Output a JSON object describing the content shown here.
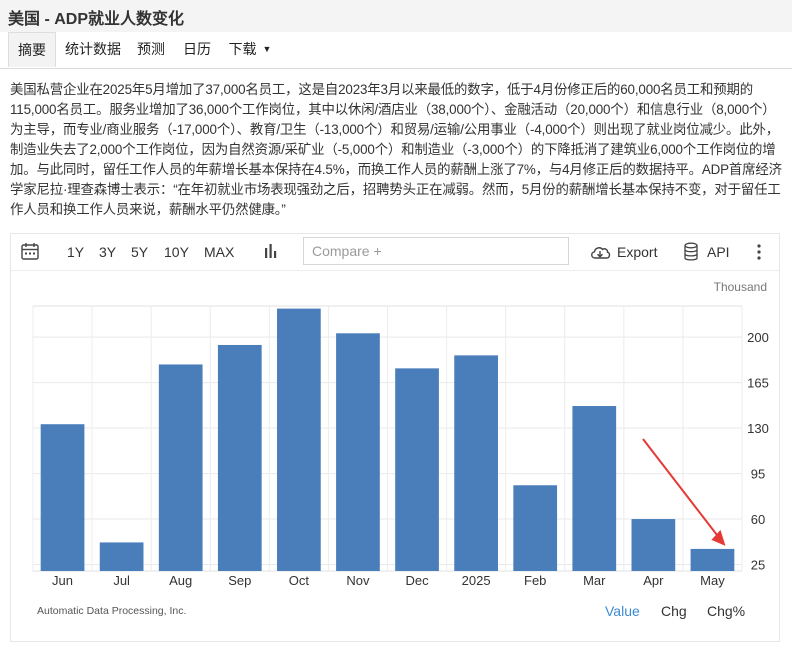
{
  "page_title": "美国 - ADP就业人数变化",
  "tabs": [
    {
      "label": "摘要"
    },
    {
      "label": "统计数据"
    },
    {
      "label": "预测"
    },
    {
      "label": "日历"
    },
    {
      "label": "下载"
    }
  ],
  "description": "美国私营企业在2025年5月增加了37,000名员工，这是自2023年3月以来最低的数字，低于4月份修正后的60,000名员工和预期的115,000名员工。服务业增加了36,000个工作岗位，其中以休闲/酒店业（38,000个）、金融活动（20,000个）和信息行业（8,000个）为主导，而专业/商业服务（-17,000个）、教育/卫生（-13,000个）和贸易/运输/公用事业（-4,000个）则出现了就业岗位减少。此外，制造业失去了2,000个工作岗位，因为自然资源/采矿业（-5,000个）和制造业（-3,000个）的下降抵消了建筑业6,000个工作岗位的增加。与此同时，留任工作人员的年薪增长基本保持在4.5%，而换工作人员的薪酬上涨了7%，与4月修正后的数据持平。ADP首席经济学家尼拉·理查森博士表示：“在年初就业市场表现强劲之后，招聘势头正在减弱。然而，5月份的薪酬增长基本保持不变，对于留任工作人员和换工作人员来说，薪酬水平仍然健康。”",
  "toolbar": {
    "ranges": [
      "1Y",
      "3Y",
      "5Y",
      "10Y",
      "MAX"
    ],
    "compare_placeholder": "Compare +",
    "export_label": "Export",
    "api_label": "API"
  },
  "chart_data": {
    "type": "bar",
    "unit_label": "Thousand",
    "categories": [
      "Jun",
      "Jul",
      "Aug",
      "Sep",
      "Oct",
      "Nov",
      "Dec",
      "2025",
      "Feb",
      "Mar",
      "Apr",
      "May"
    ],
    "values": [
      133,
      42,
      179,
      194,
      222,
      203,
      176,
      186,
      86,
      147,
      60,
      37
    ],
    "y_ticks": [
      25,
      60,
      95,
      130,
      165,
      200
    ],
    "ylim": [
      20,
      224
    ],
    "y_axis_side": "right",
    "grid": true,
    "bar_color": "#4a7ebb",
    "source": "Automatic Data Processing, Inc."
  },
  "view_options": [
    {
      "label": "Value",
      "active": true
    },
    {
      "label": "Chg",
      "active": false
    },
    {
      "label": "Chg%",
      "active": false
    }
  ],
  "colors": {
    "accent": "#3d8bd0",
    "annotation_arrow": "#e53935"
  }
}
